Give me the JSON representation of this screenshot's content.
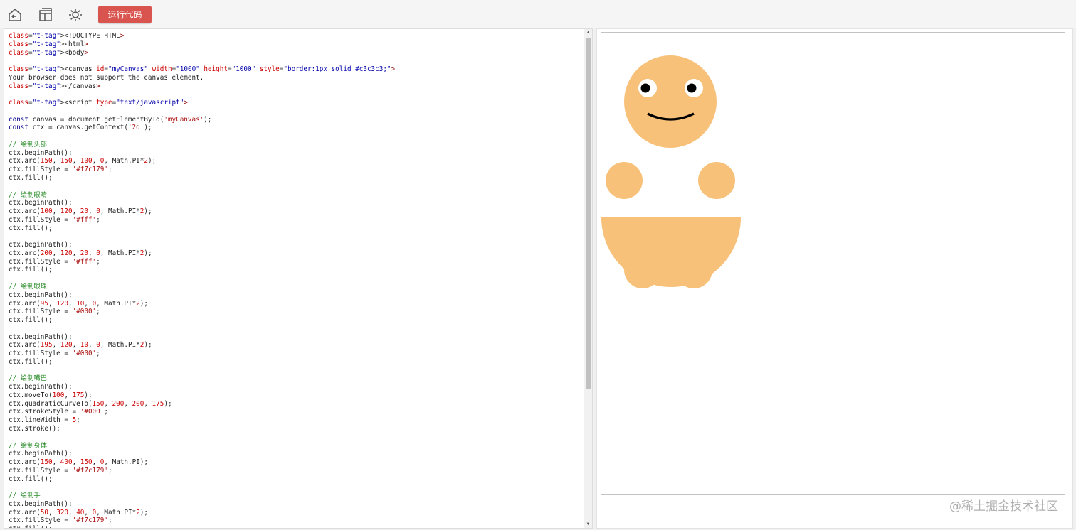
{
  "toolbar": {
    "back_icon": "home-back-icon",
    "layout_icon": "layout-icon",
    "theme_icon": "brightness-icon",
    "run_label": "运行代码",
    "run_color": "#d9534f"
  },
  "editor": {
    "lines": [
      "<!DOCTYPE HTML>",
      "<html>",
      "<body>",
      "",
      "<canvas id=\"myCanvas\" width=\"1000\" height=\"1000\" style=\"border:1px solid #c3c3c3;\">",
      "Your browser does not support the canvas element.",
      "</canvas>",
      "",
      "<script type=\"text/javascript\">",
      "",
      "const canvas = document.getElementById('myCanvas');",
      "const ctx = canvas.getContext('2d');",
      "",
      "// 绘制头部",
      "ctx.beginPath();",
      "ctx.arc(150, 150, 100, 0, Math.PI*2);",
      "ctx.fillStyle = '#f7c179';",
      "ctx.fill();",
      "",
      "// 绘制眼睛",
      "ctx.beginPath();",
      "ctx.arc(100, 120, 20, 0, Math.PI*2);",
      "ctx.fillStyle = '#fff';",
      "ctx.fill();",
      "",
      "ctx.beginPath();",
      "ctx.arc(200, 120, 20, 0, Math.PI*2);",
      "ctx.fillStyle = '#fff';",
      "ctx.fill();",
      "",
      "// 绘制眼珠",
      "ctx.beginPath();",
      "ctx.arc(95, 120, 10, 0, Math.PI*2);",
      "ctx.fillStyle = '#000';",
      "ctx.fill();",
      "",
      "ctx.beginPath();",
      "ctx.arc(195, 120, 10, 0, Math.PI*2);",
      "ctx.fillStyle = '#000';",
      "ctx.fill();",
      "",
      "// 绘制嘴巴",
      "ctx.beginPath();",
      "ctx.moveTo(100, 175);",
      "ctx.quadraticCurveTo(150, 200, 200, 175);",
      "ctx.strokeStyle = '#000';",
      "ctx.lineWidth = 5;",
      "ctx.stroke();",
      "",
      "// 绘制身体",
      "ctx.beginPath();",
      "ctx.arc(150, 400, 150, 0, Math.PI);",
      "ctx.fillStyle = '#f7c179';",
      "ctx.fill();",
      "",
      "// 绘制手",
      "ctx.beginPath();",
      "ctx.arc(50, 320, 40, 0, Math.PI*2);",
      "ctx.fillStyle = '#f7c179';",
      "ctx.fill();"
    ]
  },
  "preview": {
    "skin_color": "#f7c179",
    "eye_color": "#fff",
    "pupil_color": "#000",
    "border_color": "#c3c3c3"
  },
  "watermark": "@稀土掘金技术社区"
}
